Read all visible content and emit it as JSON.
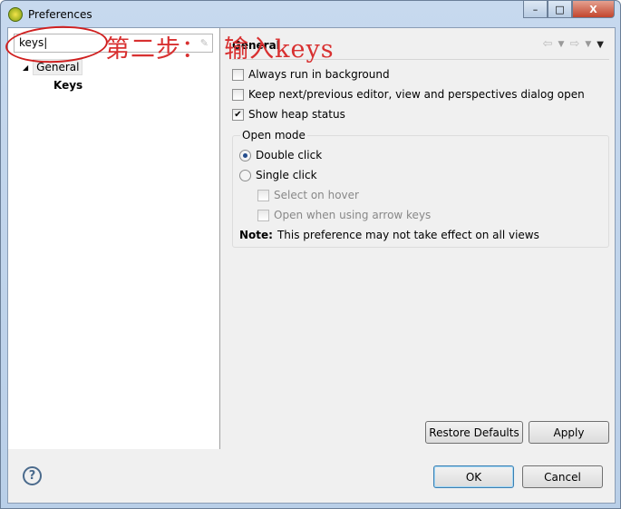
{
  "window": {
    "title": "Preferences",
    "icon": "eclipse-icon",
    "controls": {
      "minimize": "–",
      "maximize": "□",
      "close": "X"
    }
  },
  "sidebar": {
    "search_value": "keys",
    "tree": [
      {
        "label": "General",
        "expanded": true,
        "children": [
          {
            "label": "Keys"
          }
        ]
      }
    ]
  },
  "page": {
    "title": "General",
    "options": [
      {
        "label": "Always run in background",
        "checked": false
      },
      {
        "label": "Keep next/previous editor, view and perspectives dialog open",
        "checked": false
      },
      {
        "label": "Show heap status",
        "checked": true
      }
    ],
    "open_mode": {
      "label": "Open mode",
      "radios": [
        {
          "label": "Double click",
          "selected": true
        },
        {
          "label": "Single click",
          "selected": false
        }
      ],
      "sub_options": [
        {
          "label": "Select on hover",
          "checked": false,
          "enabled": false
        },
        {
          "label": "Open when using arrow keys",
          "checked": false,
          "enabled": false
        }
      ],
      "note_label": "Note:",
      "note_text": "This preference may not take effect on all views"
    },
    "restore_defaults": "Restore Defaults",
    "apply": "Apply"
  },
  "footer": {
    "ok": "OK",
    "cancel": "Cancel",
    "help": "?"
  },
  "annotation": {
    "text": "第二步：  输入keys",
    "color": "#d83030"
  }
}
